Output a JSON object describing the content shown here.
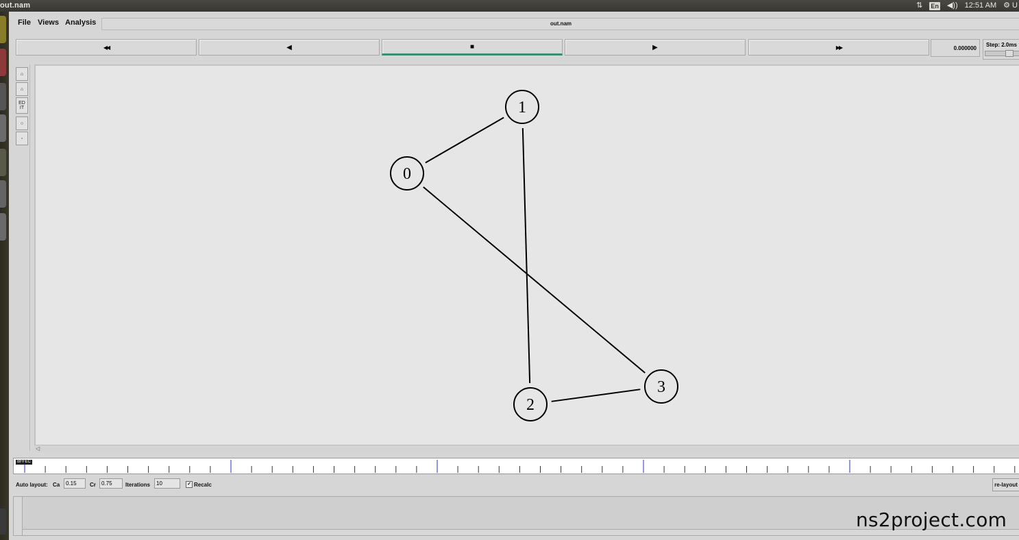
{
  "topbar": {
    "title": "out.nam",
    "lang": "En",
    "clock": "12:51 AM"
  },
  "menu": {
    "file": "File",
    "views": "Views",
    "analysis": "Analysis"
  },
  "window_title": "out.nam",
  "transport": {
    "rewind": "◀◀",
    "back": "◀",
    "stop": "■",
    "play": "▶",
    "fastforward": "▶▶",
    "time": "0.000000",
    "step_label": "Step: 2.0ms"
  },
  "tools": {
    "edit": "ED\nIT"
  },
  "topology": {
    "nodes": [
      {
        "id": "0"
      },
      {
        "id": "1"
      },
      {
        "id": "2"
      },
      {
        "id": "3"
      }
    ],
    "links": [
      [
        "0",
        "1"
      ],
      [
        "1",
        "2"
      ],
      [
        "0",
        "3"
      ],
      [
        "2",
        "3"
      ]
    ]
  },
  "timeline": {
    "knob": "BFFEC"
  },
  "autolayout": {
    "label": "Auto layout:",
    "ca_label": "Ca",
    "ca_value": "0.15",
    "cr_label": "Cr",
    "cr_value": "0.75",
    "iter_label": "Iterations",
    "iter_value": "10",
    "recalc_label": "Recalc",
    "recalc_checked": true,
    "relayout": "re-layout"
  },
  "watermark": "ns2project.com"
}
